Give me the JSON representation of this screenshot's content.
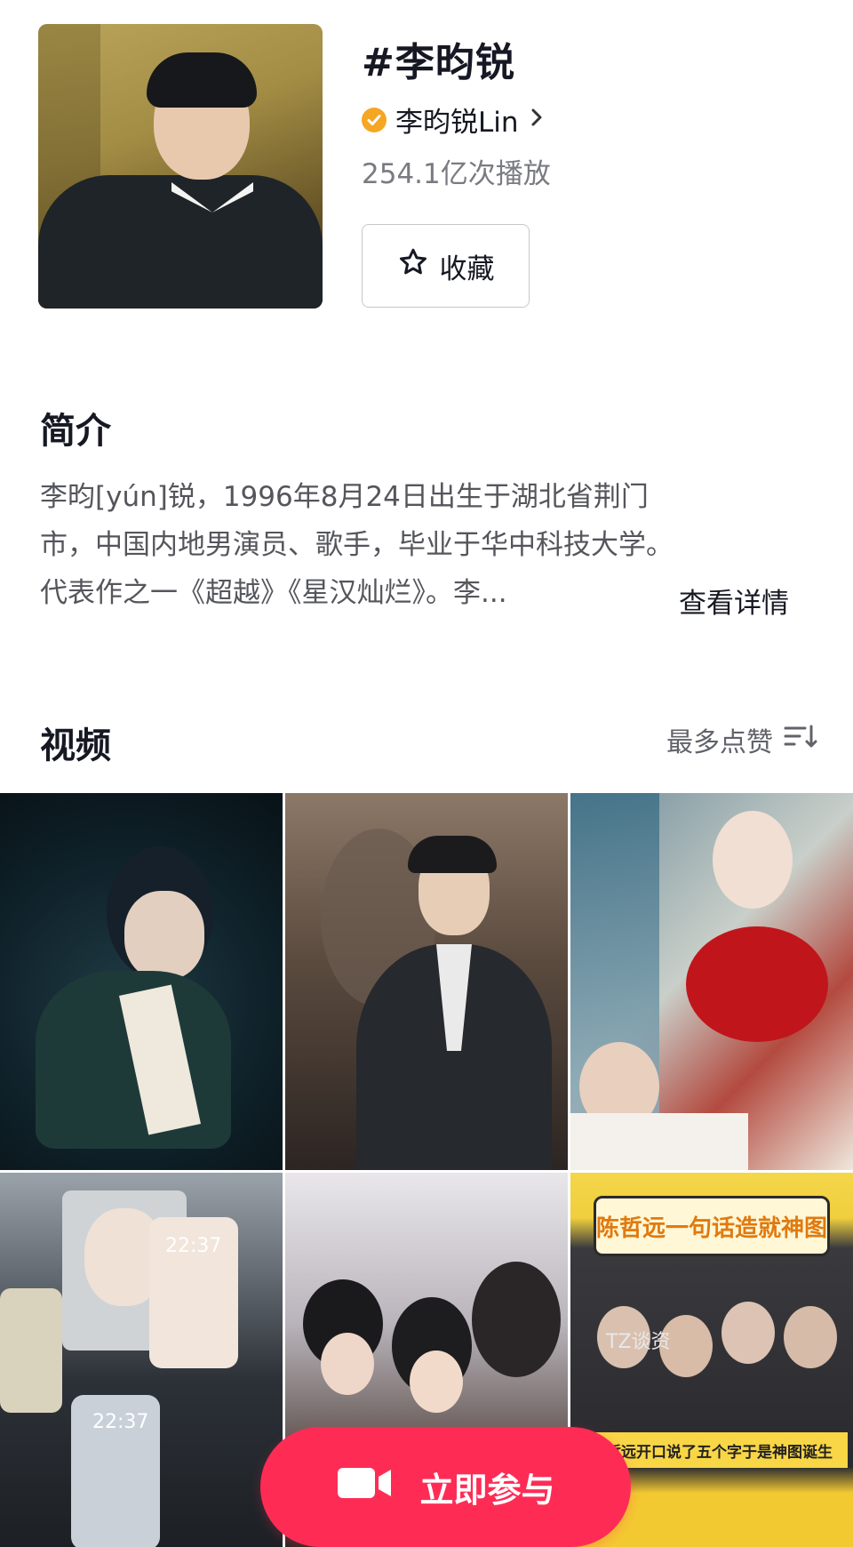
{
  "header": {
    "title": "#李昀锐",
    "author": "李昀锐Lin",
    "plays": "254.1亿次播放",
    "favorite_label": "收藏"
  },
  "intro": {
    "heading": "简介",
    "lines": [
      "李昀[yún]锐，1996年8月24日出生于湖北省荆门",
      "市，中国内地男演员、歌手，毕业于华中科技大学。",
      "代表作之一《超越》《星汉灿烂》。李..."
    ],
    "detail_link": "查看详情"
  },
  "videos": {
    "heading": "视频",
    "sort_label": "最多点赞",
    "tiles": [
      {
        "caption": ""
      },
      {
        "caption": ""
      },
      {
        "caption": ""
      },
      {
        "caption": "",
        "clock_top": "22:37",
        "clock_bottom": "22:37"
      },
      {
        "caption": ""
      },
      {
        "caption": "陈哲远一句话造就神图",
        "strip": "陈哲远开口说了五个字于是神图诞生",
        "logo": "TZ谈资"
      }
    ]
  },
  "join_button": {
    "label": "立即参与"
  },
  "colors": {
    "accent": "#fe2c55",
    "verified": "#f5a623"
  }
}
